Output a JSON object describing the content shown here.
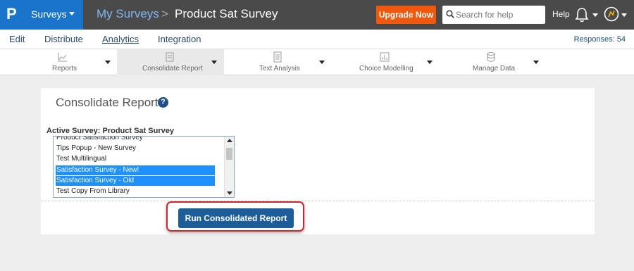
{
  "topbar": {
    "logo_letter": "P",
    "product_menu": "Surveys",
    "breadcrumb_parent": "My Surveys",
    "breadcrumb_separator": ">",
    "breadcrumb_current": "Product Sat Survey",
    "upgrade_label": "Upgrade Now",
    "search_placeholder": "Search for help",
    "help_label": "Help",
    "colors": {
      "bar": "#4a4a4a",
      "brand": "#1a74c9",
      "upgrade": "#f0580e"
    }
  },
  "menu": {
    "items": [
      "Edit",
      "Distribute",
      "Analytics",
      "Integration"
    ],
    "active": "Analytics",
    "responses": "Responses: 54"
  },
  "toolbar": {
    "tools": [
      {
        "label": "Reports",
        "icon": "line-chart-icon"
      },
      {
        "label": "Consolidate Report",
        "icon": "consolidate-icon",
        "active": true
      },
      {
        "label": "Text Analysis",
        "icon": "document-icon"
      },
      {
        "label": "Choice Modelling",
        "icon": "bar-chart-icon"
      },
      {
        "label": "Manage Data",
        "icon": "database-icon"
      }
    ]
  },
  "panel": {
    "title": "Consolidate Report",
    "help_icon": "?",
    "active_survey_label": "Active Survey: Product Sat Survey",
    "surveys": [
      {
        "name": "Product Satisfaction Survey",
        "selected": false
      },
      {
        "name": "Tips Popup - New Survey",
        "selected": false
      },
      {
        "name": "Test Multilingual",
        "selected": false
      },
      {
        "name": "Satisfaction Survey - New!",
        "selected": true
      },
      {
        "name": "Satisfaction Survey - Old",
        "selected": true
      },
      {
        "name": "Test Copy From Library",
        "selected": false
      }
    ],
    "run_button": "Run Consolidated Report",
    "colors": {
      "selection": "#1e90ff",
      "button": "#1d5d9a",
      "highlight": "#d0272c"
    }
  }
}
